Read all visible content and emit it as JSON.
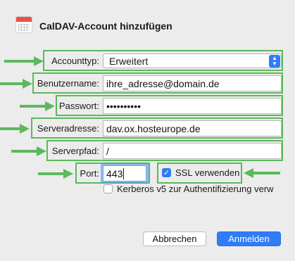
{
  "window": {
    "title": "CalDAV-Account hinzufügen",
    "icon": "calendar-icon"
  },
  "form": {
    "account_type_label": "Accounttyp:",
    "account_type_value": "Erweitert",
    "username_label": "Benutzername:",
    "username_value": "ihre_adresse@domain.de",
    "password_label": "Passwort:",
    "password_value": "••••••••••",
    "server_address_label": "Serveradresse:",
    "server_address_value": "dav.ox.hosteurope.de",
    "server_path_label": "Serverpfad:",
    "server_path_value": "/",
    "port_label": "Port:",
    "port_value": "443",
    "ssl_label": "SSL verwenden",
    "ssl_checked": true,
    "kerberos_label": "Kerberos v5 zur Authentifizierung verw",
    "kerberos_checked": false
  },
  "buttons": {
    "cancel": "Abbrechen",
    "confirm": "Anmelden"
  },
  "colors": {
    "highlight": "#5cb85c",
    "accent": "#2f7cf6"
  }
}
